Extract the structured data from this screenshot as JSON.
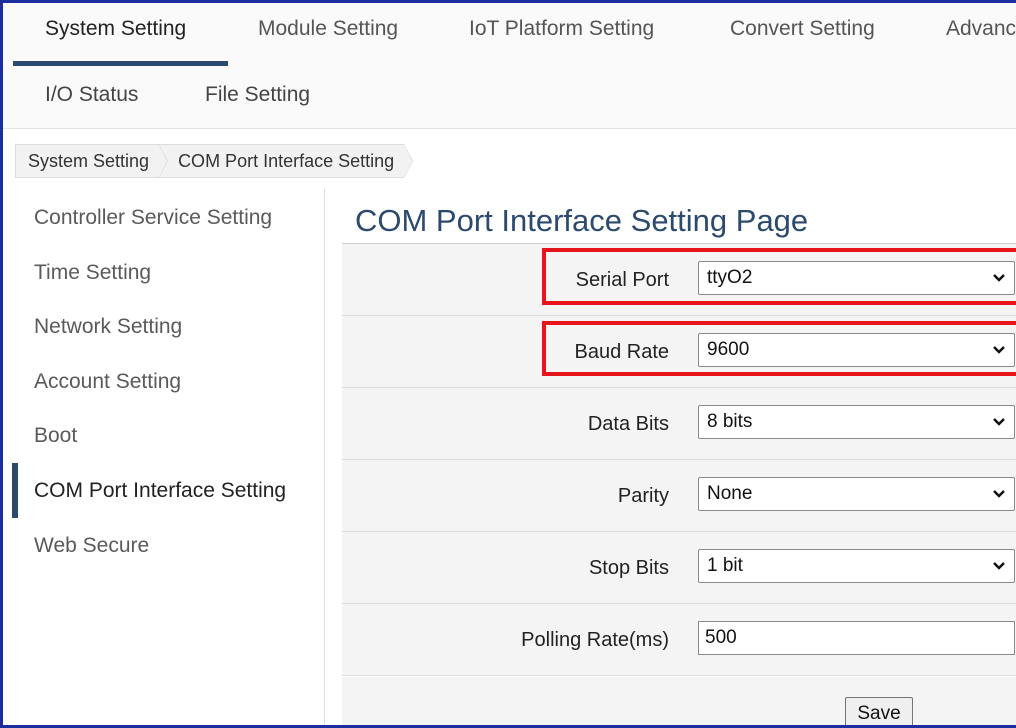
{
  "topnav": {
    "tabs": [
      "System Setting",
      "Module Setting",
      "IoT Platform Setting",
      "Convert Setting",
      "Advanc"
    ],
    "active": "System Setting"
  },
  "subnav": {
    "tabs": [
      "I/O Status",
      "File Setting"
    ]
  },
  "breadcrumb": [
    "System Setting",
    "COM Port Interface Setting"
  ],
  "sidemenu": {
    "items": [
      "Controller Service Setting",
      "Time Setting",
      "Network Setting",
      "Account Setting",
      "Boot",
      "COM Port Interface Setting",
      "Web Secure"
    ],
    "active": "COM Port Interface Setting"
  },
  "page": {
    "title": "COM Port Interface Setting Page"
  },
  "form": {
    "serial_port": {
      "label": "Serial Port",
      "value": "ttyO2"
    },
    "baud_rate": {
      "label": "Baud Rate",
      "value": "9600"
    },
    "data_bits": {
      "label": "Data Bits",
      "value": "8 bits"
    },
    "parity": {
      "label": "Parity",
      "value": "None"
    },
    "stop_bits": {
      "label": "Stop Bits",
      "value": "1 bit"
    },
    "polling_rate": {
      "label": "Polling Rate(ms)",
      "value": "500"
    },
    "save_label": "Save"
  },
  "colors": {
    "accent": "#2c4a6e",
    "highlight": "#e8141b",
    "frame": "#1a2e9e"
  }
}
